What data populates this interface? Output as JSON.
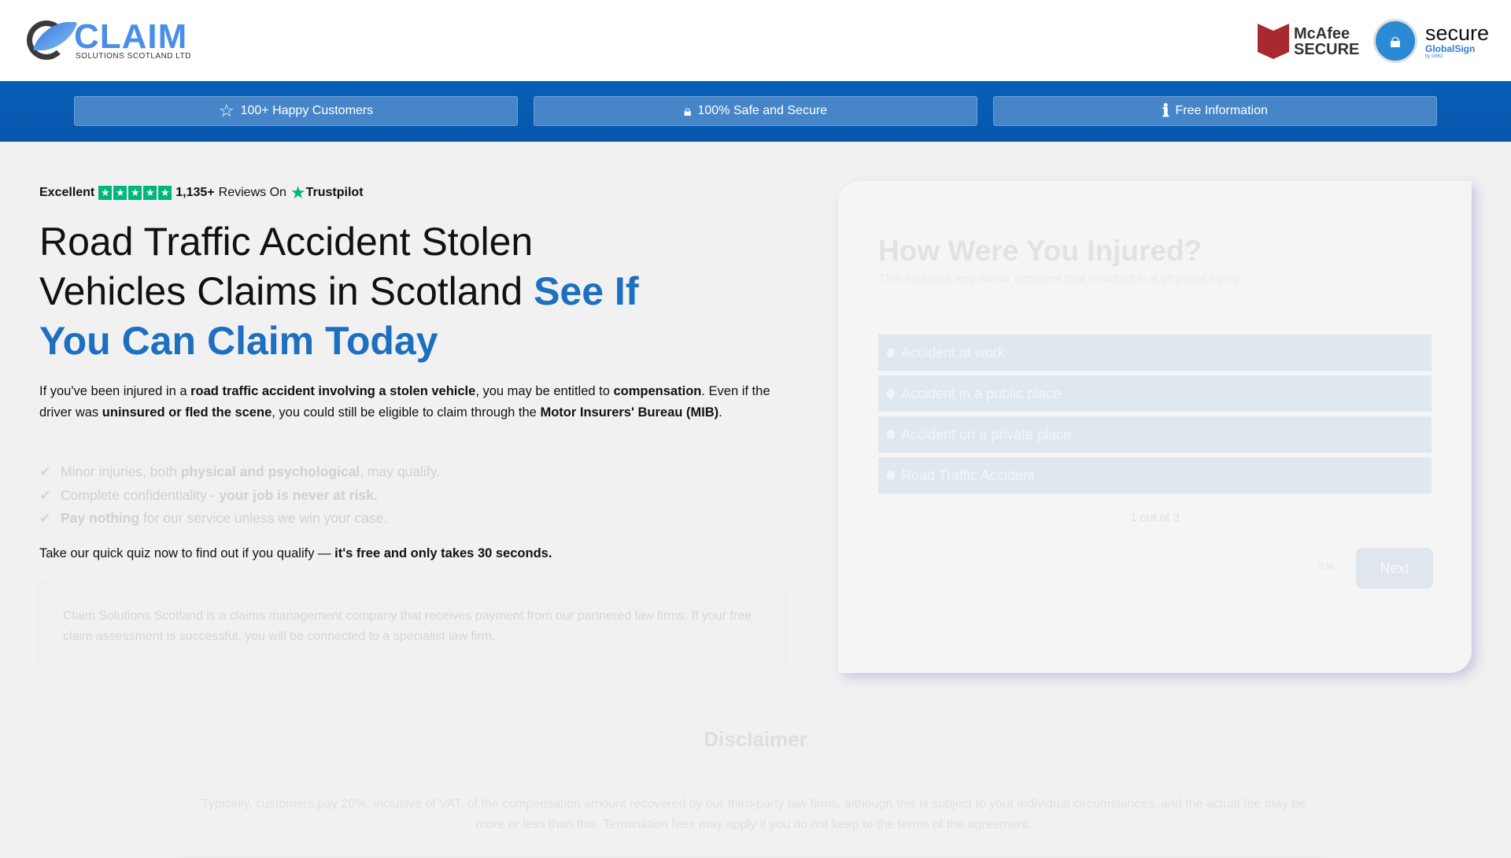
{
  "header": {
    "logo_word": "CLAIM",
    "logo_sub": "SOLUTIONS SCOTLAND LTD",
    "mcafee_line1": "McAfee",
    "mcafee_line2": "SECURE",
    "gs_line1": "secure",
    "gs_line2": "GlobalSign",
    "gs_line3": "by GMO"
  },
  "band": [
    {
      "icon": "star-icon",
      "label": "100+ Happy Customers"
    },
    {
      "icon": "lock-icon",
      "label": "100% Safe and Secure"
    },
    {
      "icon": "info-icon",
      "label": "Free Information"
    }
  ],
  "trustpilot": {
    "rating": "Excellent",
    "count": "1,135+",
    "reviews_on": "Reviews On",
    "brand": "Trustpilot"
  },
  "headline": {
    "part1": "Road Traffic Accident Stolen Vehicles Claims in Scotland ",
    "highlight": "See If You Can Claim Today"
  },
  "intro": {
    "t1": "If you've been injured in a ",
    "b1": "road traffic accident involving a stolen vehicle",
    "t2": ", you may be entitled to ",
    "b2": "compensation",
    "t3": ". Even if the driver was ",
    "b3": "uninsured or fled the scene",
    "t4": ", you could still be eligible to claim through the ",
    "b4": "Motor Insurers' Bureau (MIB)",
    "t5": "."
  },
  "checks": [
    {
      "a": "Minor injuries, both ",
      "b": "physical and psychological",
      "c": ", may qualify."
    },
    {
      "a": "Complete confidentiality - ",
      "b": "your job is never at risk.",
      "c": ""
    },
    {
      "a": "",
      "b": "Pay nothing",
      "c": " for our service unless we win your case."
    }
  ],
  "quiz_cta": {
    "text": "Take our quick quiz now to find out if you qualify — ",
    "bold": "it's free and only takes 30 seconds."
  },
  "notice": "Claim Solutions Scotland is a claims management company that receives payment from our partnered law firms. If your free claim assessment is successful, you will be connected to a specialist law firm.",
  "quiz": {
    "title": "How Were You Injured?",
    "subtitle": "This includes any minor accident that resulted in a physical injury",
    "options": [
      "Accident at work",
      "Accident in a public place",
      "Accident on a private place",
      "Road Traffic Accident"
    ],
    "step": "1 out of 3",
    "progress": "0 %",
    "next": "Next"
  },
  "disclaimer": {
    "title": "Disclaimer",
    "text": "Typically, customers pay 20%, inclusive of VAT, of the compensation amount recovered by our third-party law firms, although this is subject to your individual circumstances, and the actual fee may be more or less than this. Termination fees may apply if you do not keep to the terms of the agreement."
  }
}
